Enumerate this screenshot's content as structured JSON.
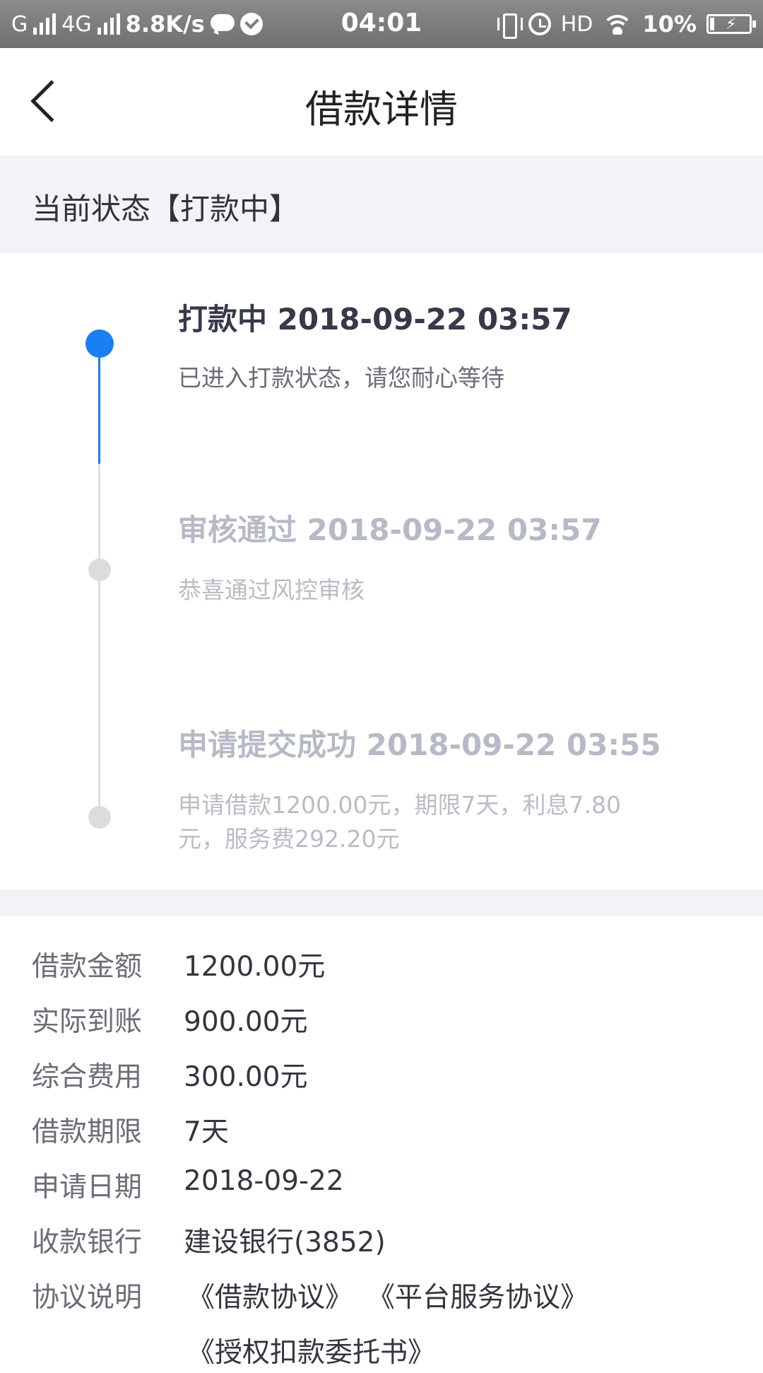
{
  "status_bar": {
    "carrier1": "G",
    "carrier2": "4G",
    "speed": "8.8K/s",
    "time": "04:01",
    "hd": "HD",
    "battery": "10%",
    "icons": [
      "signal-icon",
      "chat-bubble-icon",
      "check-circle-icon",
      "vibrate-icon",
      "alarm-icon",
      "wifi-icon",
      "battery-icon"
    ]
  },
  "header": {
    "title": "借款详情",
    "back_icon": "chevron-left-icon"
  },
  "current_status": {
    "text": "当前状态【打款中】"
  },
  "timeline": [
    {
      "title": "打款中 2018-09-22 03:57",
      "desc": "已进入打款状态，请您耐心等待",
      "active": true
    },
    {
      "title": "审核通过 2018-09-22 03:57",
      "desc": "恭喜通过风控审核",
      "active": false
    },
    {
      "title": "申请提交成功 2018-09-22 03:55",
      "desc_line1": "申请借款1200.00元，期限7天，利息7.80",
      "desc_line2": "元，服务费292.20元",
      "active": false
    }
  ],
  "details": {
    "loan_amount_label": "借款金额",
    "loan_amount": "1200.00元",
    "actual_received_label": "实际到账",
    "actual_received": "900.00元",
    "total_fee_label": "综合费用",
    "total_fee": "300.00元",
    "term_label": "借款期限",
    "term": "7天",
    "apply_date_label": "申请日期",
    "apply_date": "2018-09-22",
    "bank_label": "收款银行",
    "bank": "建设银行(3852)",
    "agreement_label": "协议说明",
    "agreements": [
      "《借款协议》",
      "《平台服务协议》",
      "《授权扣款委托书》"
    ]
  },
  "colors": {
    "accent": "#1a7ff5",
    "link": "#3b6fc4",
    "section_bg": "#f1f3f8"
  }
}
